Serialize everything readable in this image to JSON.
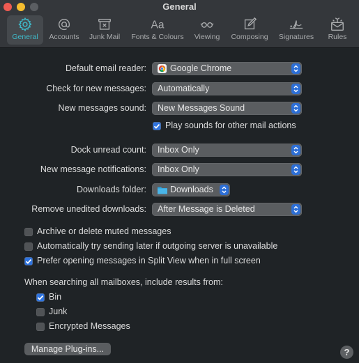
{
  "window": {
    "title": "General"
  },
  "toolbar": {
    "tabs": [
      {
        "id": "general",
        "label": "General",
        "icon": "gear-icon",
        "active": true
      },
      {
        "id": "accounts",
        "label": "Accounts",
        "icon": "at-sign-icon",
        "active": false
      },
      {
        "id": "junk",
        "label": "Junk Mail",
        "icon": "junk-tray-icon",
        "active": false
      },
      {
        "id": "fonts",
        "label": "Fonts & Colours",
        "icon": "font-aa-icon",
        "active": false
      },
      {
        "id": "viewing",
        "label": "Viewing",
        "icon": "glasses-icon",
        "active": false
      },
      {
        "id": "composing",
        "label": "Composing",
        "icon": "compose-icon",
        "active": false
      },
      {
        "id": "signatures",
        "label": "Signatures",
        "icon": "signature-icon",
        "active": false
      },
      {
        "id": "rules",
        "label": "Rules",
        "icon": "rules-envelope-icon",
        "active": false
      }
    ]
  },
  "settings": {
    "default_reader": {
      "label": "Default email reader:",
      "value": "Google Chrome",
      "icon": "chrome-icon"
    },
    "check_new": {
      "label": "Check for new messages:",
      "value": "Automatically"
    },
    "new_sound": {
      "label": "New messages sound:",
      "value": "New Messages Sound"
    },
    "play_sounds": {
      "label": "Play sounds for other mail actions",
      "checked": true
    },
    "dock_unread": {
      "label": "Dock unread count:",
      "value": "Inbox Only"
    },
    "notifications": {
      "label": "New message notifications:",
      "value": "Inbox Only"
    },
    "downloads_folder": {
      "label": "Downloads folder:",
      "value": "Downloads",
      "icon": "folder-icon"
    },
    "remove_downloads": {
      "label": "Remove unedited downloads:",
      "value": "After Message is Deleted"
    },
    "archive_muted": {
      "label": "Archive or delete muted messages",
      "checked": false
    },
    "send_later": {
      "label": "Automatically try sending later if outgoing server is unavailable",
      "checked": false
    },
    "split_view": {
      "label": "Prefer opening messages in Split View when in full screen",
      "checked": true
    }
  },
  "search": {
    "title": "When searching all mailboxes, include results from:",
    "options": [
      {
        "label": "Bin",
        "checked": true
      },
      {
        "label": "Junk",
        "checked": false
      },
      {
        "label": "Encrypted Messages",
        "checked": false
      }
    ]
  },
  "buttons": {
    "manage_plugins": "Manage Plug-ins...",
    "help": "?"
  },
  "colors": {
    "accent": "#2f74e0",
    "active_tab": "#3fb8c7"
  }
}
